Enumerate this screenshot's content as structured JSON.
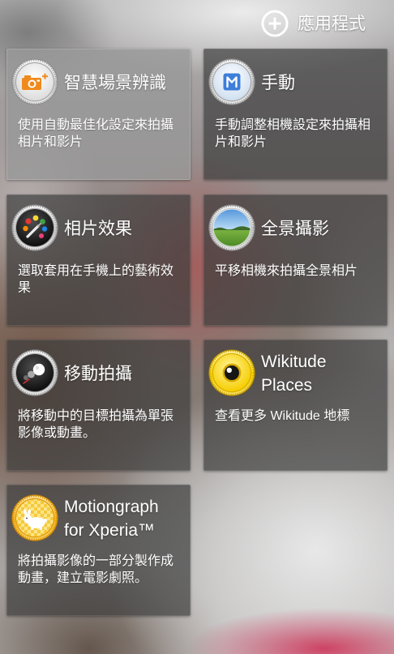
{
  "header": {
    "apps_button": {
      "icon": "plus-circle-icon",
      "label": "應用程式"
    }
  },
  "modes": [
    {
      "icon": "smart-scene-camera-icon",
      "title_lines": [
        "智慧場景辨識"
      ],
      "description_lines": [
        "使用自動最佳化設定來拍攝",
        "相片和影片"
      ],
      "highlighted": true
    },
    {
      "icon": "manual-m-icon",
      "title_lines": [
        "手動"
      ],
      "description_lines": [
        "手動調整相機設定來拍攝相",
        "片和影片"
      ],
      "highlighted": false
    },
    {
      "icon": "photo-effect-palette-icon",
      "title_lines": [
        "相片效果"
      ],
      "description_lines": [
        "選取套用在手機上的藝術效",
        "果"
      ],
      "highlighted": false
    },
    {
      "icon": "sweep-panorama-icon",
      "title_lines": [
        "全景攝影"
      ],
      "description_lines": [
        "平移相機來拍攝全景相片"
      ],
      "highlighted": false
    },
    {
      "icon": "motion-shot-icon",
      "title_lines": [
        "移動拍攝"
      ],
      "description_lines": [
        "將移動中的目標拍攝為單張",
        "影像或動畫。"
      ],
      "highlighted": false
    },
    {
      "icon": "wikitude-eye-icon",
      "title_lines": [
        "Wikitude",
        "Places"
      ],
      "description_lines": [
        "查看更多 Wikitude 地標"
      ],
      "highlighted": false
    },
    {
      "icon": "motiongraph-rabbit-icon",
      "title_lines": [
        "Motiongraph",
        "for Xperia™"
      ],
      "description_lines": [
        "將拍攝影像的一部分製作成",
        "動畫，建立電影劇照。"
      ],
      "highlighted": false
    }
  ],
  "colors": {
    "text": "#ffffff",
    "card": "#3a3a3aae",
    "card_highlighted": "#989898cc",
    "smart_scene_orange": "#f08a1c",
    "manual_blue": "#3d7fd9",
    "wikitude_yellow": "#f5cc00"
  }
}
